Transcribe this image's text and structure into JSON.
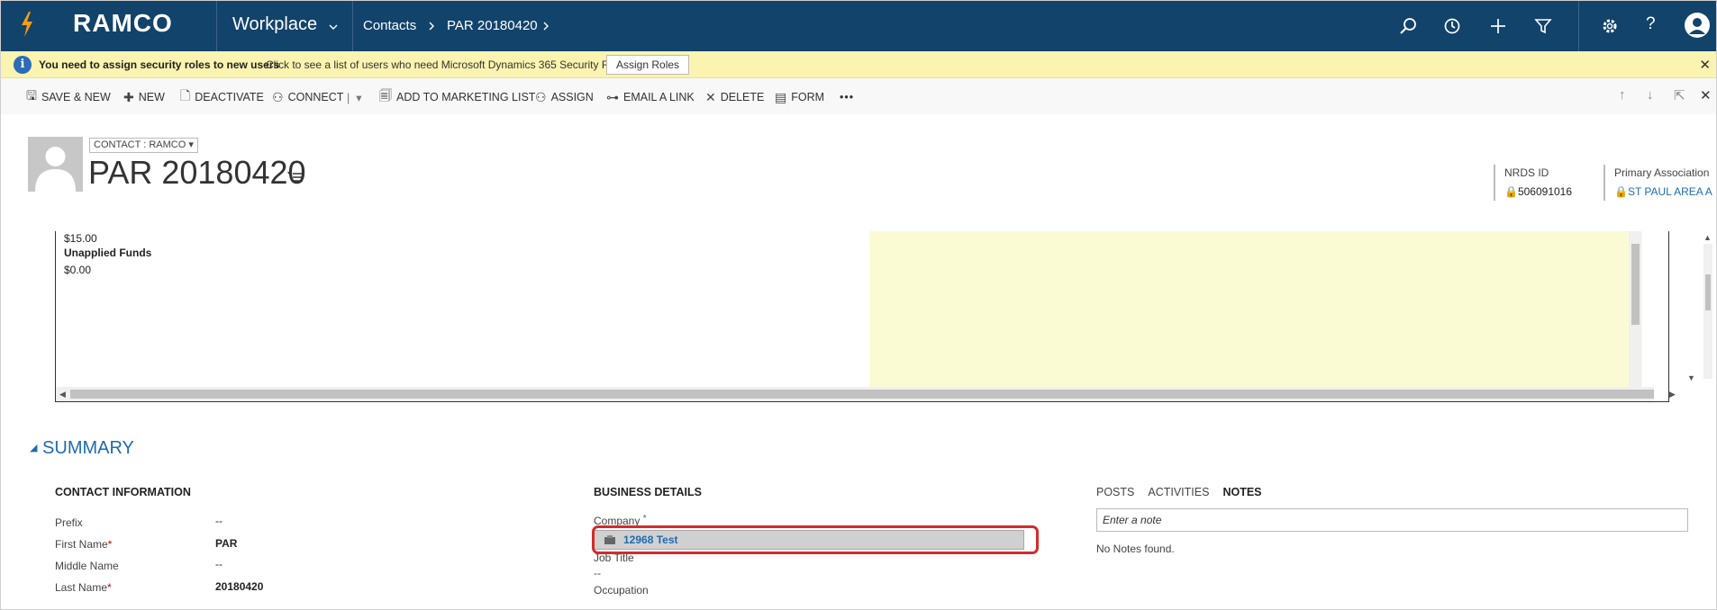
{
  "topnav": {
    "logo": "RAMCO",
    "app": "Workplace",
    "breadcrumbs": [
      "Contacts",
      "PAR 20180420"
    ],
    "icons": [
      "search-icon",
      "history-icon",
      "plus-icon",
      "filter-icon",
      "gear-icon",
      "help-icon",
      "user-icon"
    ]
  },
  "notification": {
    "title": "You need to assign security roles to new users",
    "message": "Click to see a list of users who need Microsoft Dynamics 365 Security Roles.",
    "button": "Assign Roles"
  },
  "commands": {
    "save_new": "SAVE & NEW",
    "new": "NEW",
    "deactivate": "DEACTIVATE",
    "connect": "CONNECT",
    "add_to_marketing_list": "ADD TO MARKETING LIST",
    "assign": "ASSIGN",
    "email_link": "EMAIL A LINK",
    "delete": "DELETE",
    "form": "FORM",
    "more": "•••"
  },
  "record": {
    "form_selector": "CONTACT : RAMCO",
    "title": "PAR 20180420",
    "header_fields": [
      {
        "label": "NRDS ID",
        "value": "506091016"
      },
      {
        "label": "Primary Association",
        "value": "ST PAUL AREA A"
      }
    ]
  },
  "embedded": {
    "line1": "$15.00",
    "line2": "Unapplied Funds",
    "line3": "$0.00"
  },
  "summary": {
    "heading": "SUMMARY",
    "contact_info": {
      "title": "CONTACT INFORMATION",
      "fields": [
        {
          "label": "Prefix",
          "required": "",
          "value": "--"
        },
        {
          "label": "First Name",
          "required": "*",
          "value": "PAR"
        },
        {
          "label": "Middle Name",
          "required": "",
          "value": "--"
        },
        {
          "label": "Last Name",
          "required": "*",
          "value": "20180420"
        }
      ]
    },
    "business": {
      "title": "BUSINESS DETAILS",
      "company_label": "Company",
      "company_required": "*",
      "company_value": "12968 Test",
      "job_title_label": "Job Title",
      "job_title_value": "--",
      "occupation_label": "Occupation"
    },
    "notes": {
      "tabs": [
        "POSTS",
        "ACTIVITIES",
        "NOTES"
      ],
      "active_tab": "NOTES",
      "placeholder": "Enter a note",
      "empty": "No Notes found."
    }
  }
}
